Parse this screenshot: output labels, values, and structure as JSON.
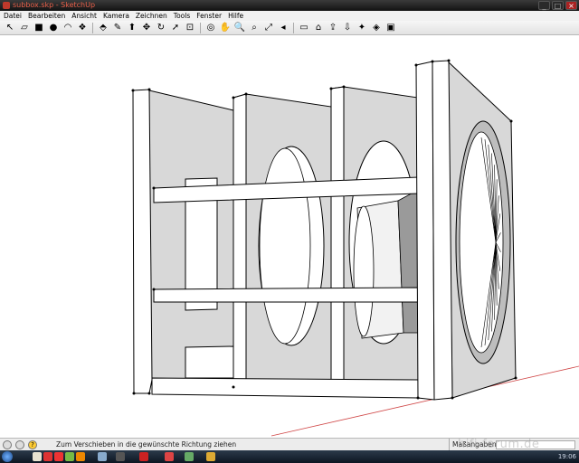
{
  "window": {
    "title": "subbox.skp - SketchUp"
  },
  "menu": [
    "Datei",
    "Bearbeiten",
    "Ansicht",
    "Kamera",
    "Zeichnen",
    "Tools",
    "Fenster",
    "Hilfe"
  ],
  "toolbar_icons": [
    {
      "name": "select-icon",
      "glyph": "↖"
    },
    {
      "name": "eraser-icon",
      "glyph": "▱"
    },
    {
      "name": "rectangle-icon",
      "glyph": "■"
    },
    {
      "name": "circle-icon",
      "glyph": "●"
    },
    {
      "name": "arc-icon",
      "glyph": "◠"
    },
    {
      "name": "make-component-icon",
      "glyph": "❖"
    },
    {
      "name": "paint-bucket-icon",
      "glyph": "⬘"
    },
    {
      "name": "tape-measure-icon",
      "glyph": "✎"
    },
    {
      "name": "push-pull-icon",
      "glyph": "⬆"
    },
    {
      "name": "move-icon",
      "glyph": "✥"
    },
    {
      "name": "rotate-icon",
      "glyph": "↻"
    },
    {
      "name": "follow-me-icon",
      "glyph": "➚"
    },
    {
      "name": "offset-icon",
      "glyph": "⊡"
    },
    {
      "name": "orbit-icon",
      "glyph": "◎"
    },
    {
      "name": "pan-icon",
      "glyph": "✋"
    },
    {
      "name": "zoom-icon",
      "glyph": "🔍"
    },
    {
      "name": "zoom-window-icon",
      "glyph": "⌕"
    },
    {
      "name": "zoom-extents-icon",
      "glyph": "⤢"
    },
    {
      "name": "previous-view-icon",
      "glyph": "◂"
    },
    {
      "name": "folder-icon",
      "glyph": "▭"
    },
    {
      "name": "warehouse-icon",
      "glyph": "⌂"
    },
    {
      "name": "share-model-icon",
      "glyph": "⇪"
    },
    {
      "name": "get-models-icon",
      "glyph": "⇩"
    },
    {
      "name": "extension-icon",
      "glyph": "✦"
    },
    {
      "name": "section-icon",
      "glyph": "◈"
    },
    {
      "name": "components-icon",
      "glyph": "▣"
    }
  ],
  "status": {
    "hint": "Zum Verschieben in die gewünschte Richtung ziehen",
    "measurements_label": "Maßangaben",
    "measurements_value": ""
  },
  "watermark": "hifi-forum.de",
  "clock": "19:06",
  "colors": {
    "panel_face": "#ffffff",
    "panel_side": "#d8d8d8",
    "edge": "#000000",
    "driver_cone": "#8c8c8c",
    "axis_red": "#d04848"
  }
}
